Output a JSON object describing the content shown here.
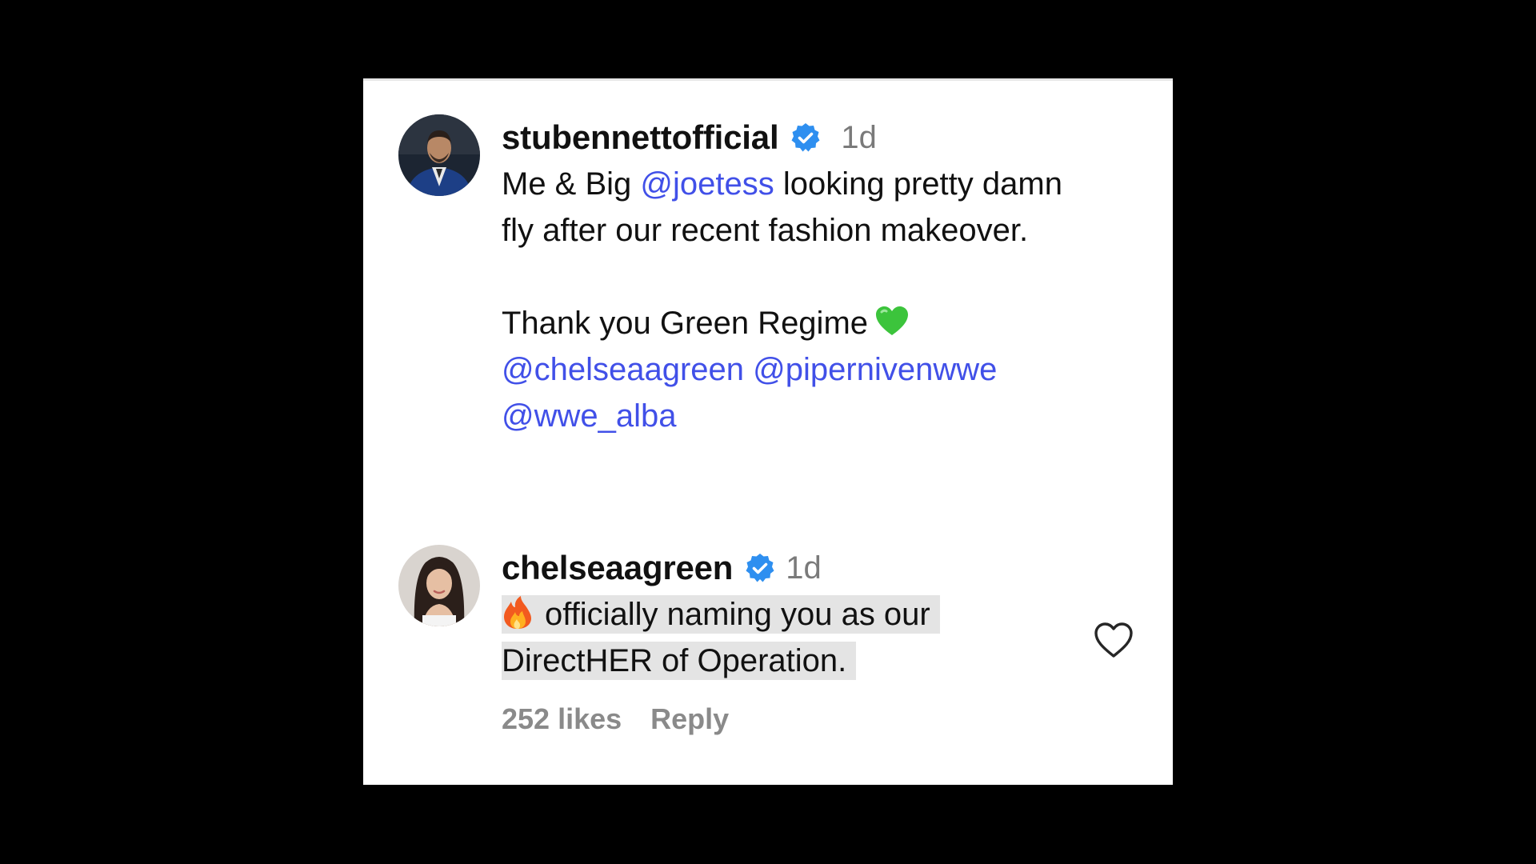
{
  "comments": [
    {
      "username": "stubennettofficial",
      "verified_icon": "verified-badge-icon",
      "timestamp": "1d",
      "text_plain_1": "Me & Big ",
      "mention_1": "@joetess",
      "text_plain_2": " looking pretty damn fly after our recent fashion makeover.",
      "text_thanks": "Thank you Green Regime",
      "emoji": "green-heart-icon",
      "mention_2": "@chelseaagreen",
      "mention_3": "@pipernivenwwe",
      "mention_4": "@wwe_alba"
    },
    {
      "username": "chelseaagreen",
      "verified_icon": "verified-badge-icon",
      "timestamp": "1d",
      "emoji": "fire-icon",
      "text_line_1": "officially naming you as our",
      "text_line_2": "DirectHER of Operation.",
      "likes": "252 likes",
      "reply_label": "Reply",
      "like_icon": "heart-outline-icon"
    }
  ],
  "colors": {
    "background": "#000000",
    "card": "#ffffff",
    "mention": "#4150e8",
    "verified": "#2e8ff0",
    "highlight": "#e4e4e4",
    "muted": "#8a8a8a"
  }
}
